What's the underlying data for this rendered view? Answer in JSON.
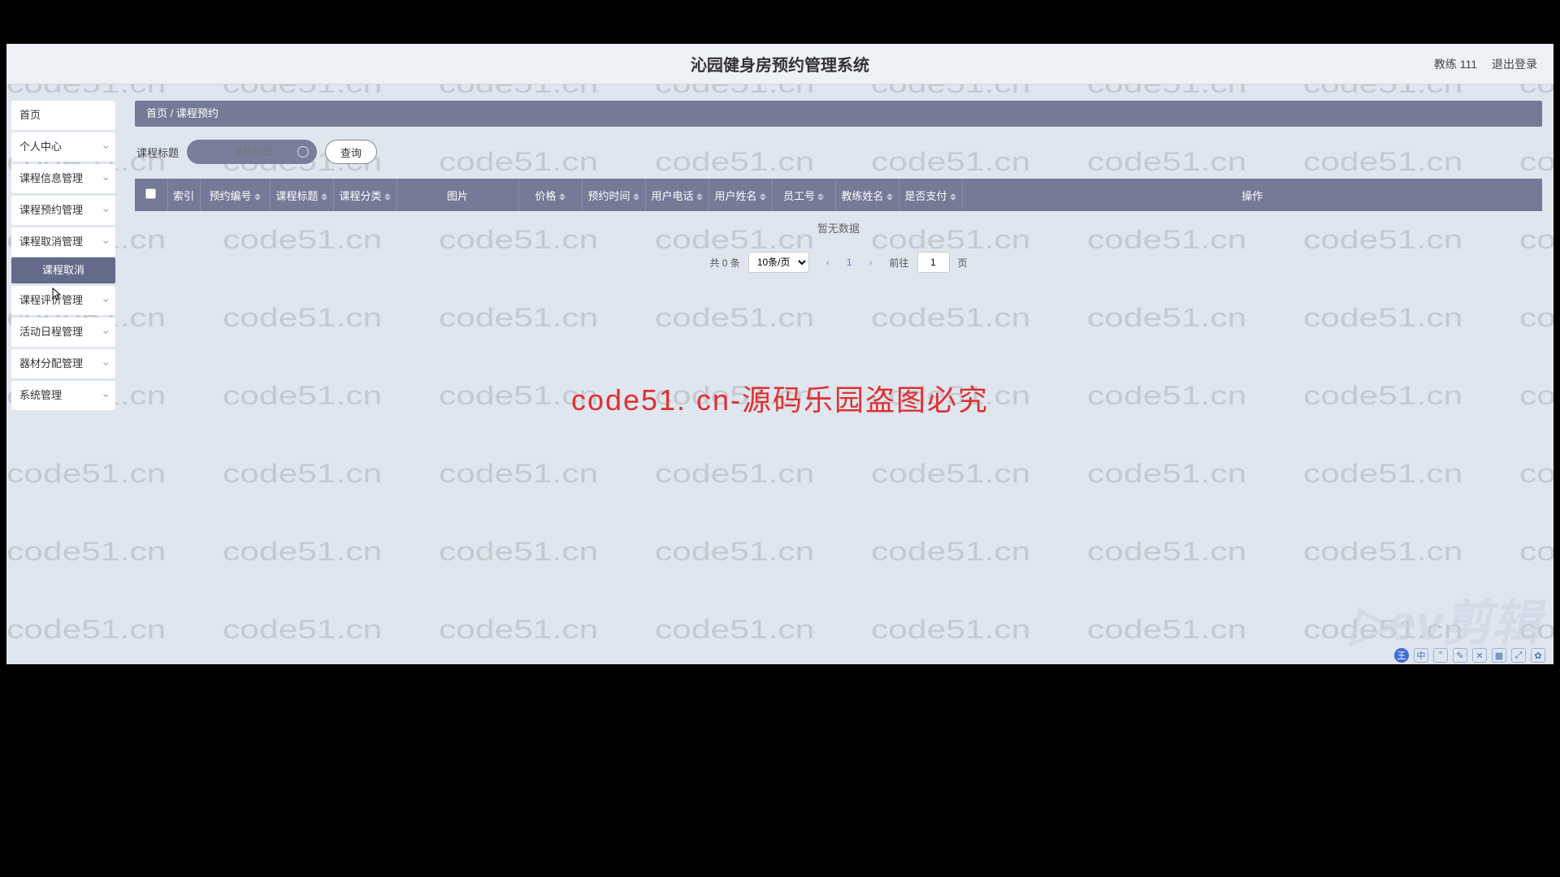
{
  "header": {
    "title": "沁园健身房预约管理系统",
    "user_label": "教练 111",
    "logout": "退出登录"
  },
  "sidebar": {
    "items": [
      {
        "label": "首页",
        "arrow": false
      },
      {
        "label": "个人中心",
        "arrow": true
      },
      {
        "label": "课程信息管理",
        "arrow": true
      },
      {
        "label": "课程预约管理",
        "arrow": true
      },
      {
        "label": "课程取消管理",
        "arrow": true
      },
      {
        "label": "课程评价管理",
        "arrow": true
      },
      {
        "label": "活动日程管理",
        "arrow": true
      },
      {
        "label": "器材分配管理",
        "arrow": true
      },
      {
        "label": "系统管理",
        "arrow": true
      }
    ],
    "sub_active": "课程取消"
  },
  "breadcrumb": {
    "home": "首页",
    "sep": " / ",
    "current": "课程预约"
  },
  "search": {
    "label": "课程标题",
    "placeholder": "课程标题",
    "query_btn": "查询"
  },
  "table": {
    "columns": [
      {
        "label": "索引",
        "sortable": false
      },
      {
        "label": "预约编号",
        "sortable": true
      },
      {
        "label": "课程标题",
        "sortable": true
      },
      {
        "label": "课程分类",
        "sortable": true
      },
      {
        "label": "图片",
        "sortable": false
      },
      {
        "label": "价格",
        "sortable": true
      },
      {
        "label": "预约时间",
        "sortable": true
      },
      {
        "label": "用户电话",
        "sortable": true
      },
      {
        "label": "用户姓名",
        "sortable": true
      },
      {
        "label": "员工号",
        "sortable": true
      },
      {
        "label": "教练姓名",
        "sortable": true
      },
      {
        "label": "是否支付",
        "sortable": true
      },
      {
        "label": "操作",
        "sortable": false
      }
    ],
    "empty_text": "暂无数据"
  },
  "pagination": {
    "total_text": "共 0 条",
    "page_size": "10条/页",
    "current": "1",
    "goto_prefix": "前往",
    "goto_value": "1",
    "goto_suffix": "页"
  },
  "watermark_big": "code51. cn-源码乐园盗图必究",
  "ev_logo": "▷ev剪辑",
  "toolbar_icons": [
    "王",
    "中",
    "°",
    "✎",
    "✕",
    "▦",
    "⤢",
    "✿"
  ]
}
